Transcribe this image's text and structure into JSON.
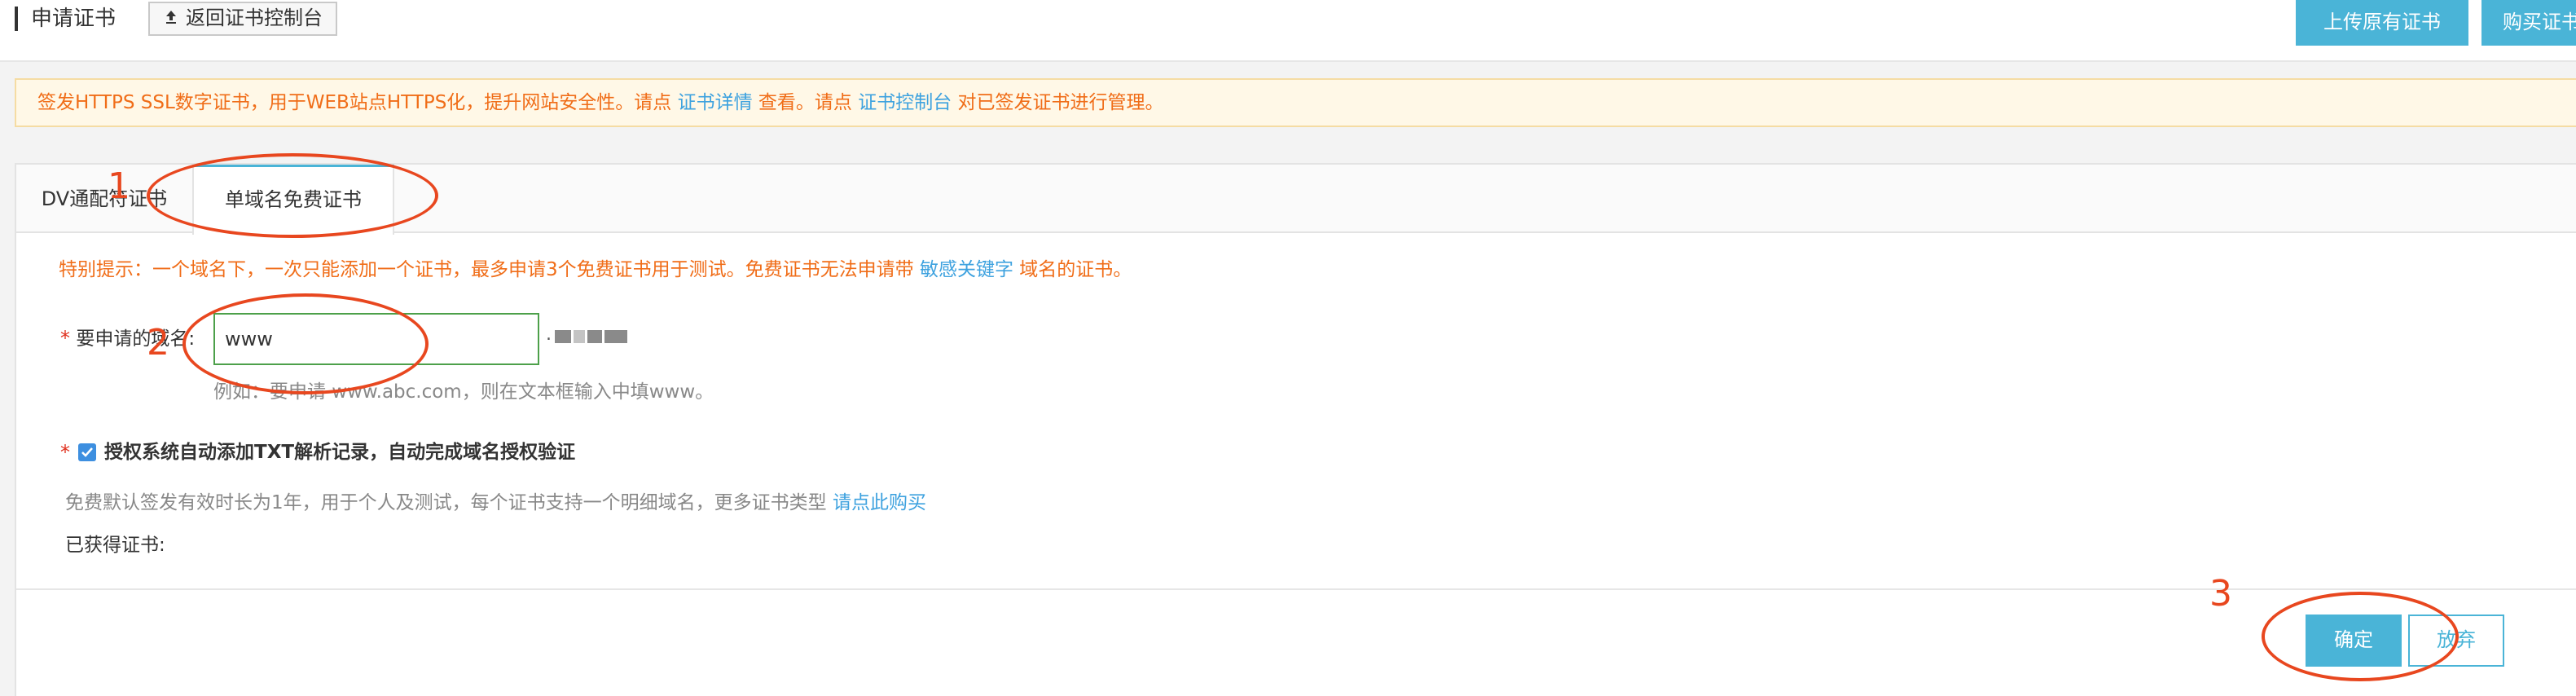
{
  "header": {
    "title": "申请证书",
    "back_button": "返回证书控制台",
    "upload_button": "上传原有证书",
    "buy_button": "购买证书"
  },
  "notice": {
    "text_1": "签发HTTPS SSL数字证书，用于WEB站点HTTPS化，提升网站安全性。请点",
    "link_1": "证书详情",
    "text_2": "查看。请点",
    "link_2": "证书控制台",
    "text_3": "对已签发证书进行管理。"
  },
  "tabs": [
    {
      "label": "DV通配符证书"
    },
    {
      "label": "单域名免费证书"
    }
  ],
  "form": {
    "tip_text_1": "特别提示：一个域名下，一次只能添加一个证书，最多申请3个免费证书用于测试。免费证书无法申请带",
    "tip_link": "敏感关键字",
    "tip_text_2": "域名的证书。",
    "required_mark": "*",
    "domain_label": "要申请的域名:",
    "domain_value": "www",
    "domain_dot": ".",
    "example": "例如：要申请 www.abc.com，则在文本框输入中填www。",
    "auth_label": "授权系统自动添加TXT解析记录，自动完成域名授权验证",
    "auth_checked": true,
    "info_text": "免费默认签发有效时长为1年，用于个人及测试，每个证书支持一个明细域名，更多证书类型",
    "info_link": "请点此购买",
    "obtained_label": "已获得证书:"
  },
  "footer": {
    "confirm": "确定",
    "cancel": "放弃"
  },
  "annotations": {
    "step1": "1",
    "step2": "2",
    "step3": "3"
  },
  "colors": {
    "primary": "#4ab4d7",
    "warning_text": "#f06d18",
    "link": "#3ea2df",
    "annotation": "#e8471f",
    "notice_bg": "#fff8e7"
  }
}
